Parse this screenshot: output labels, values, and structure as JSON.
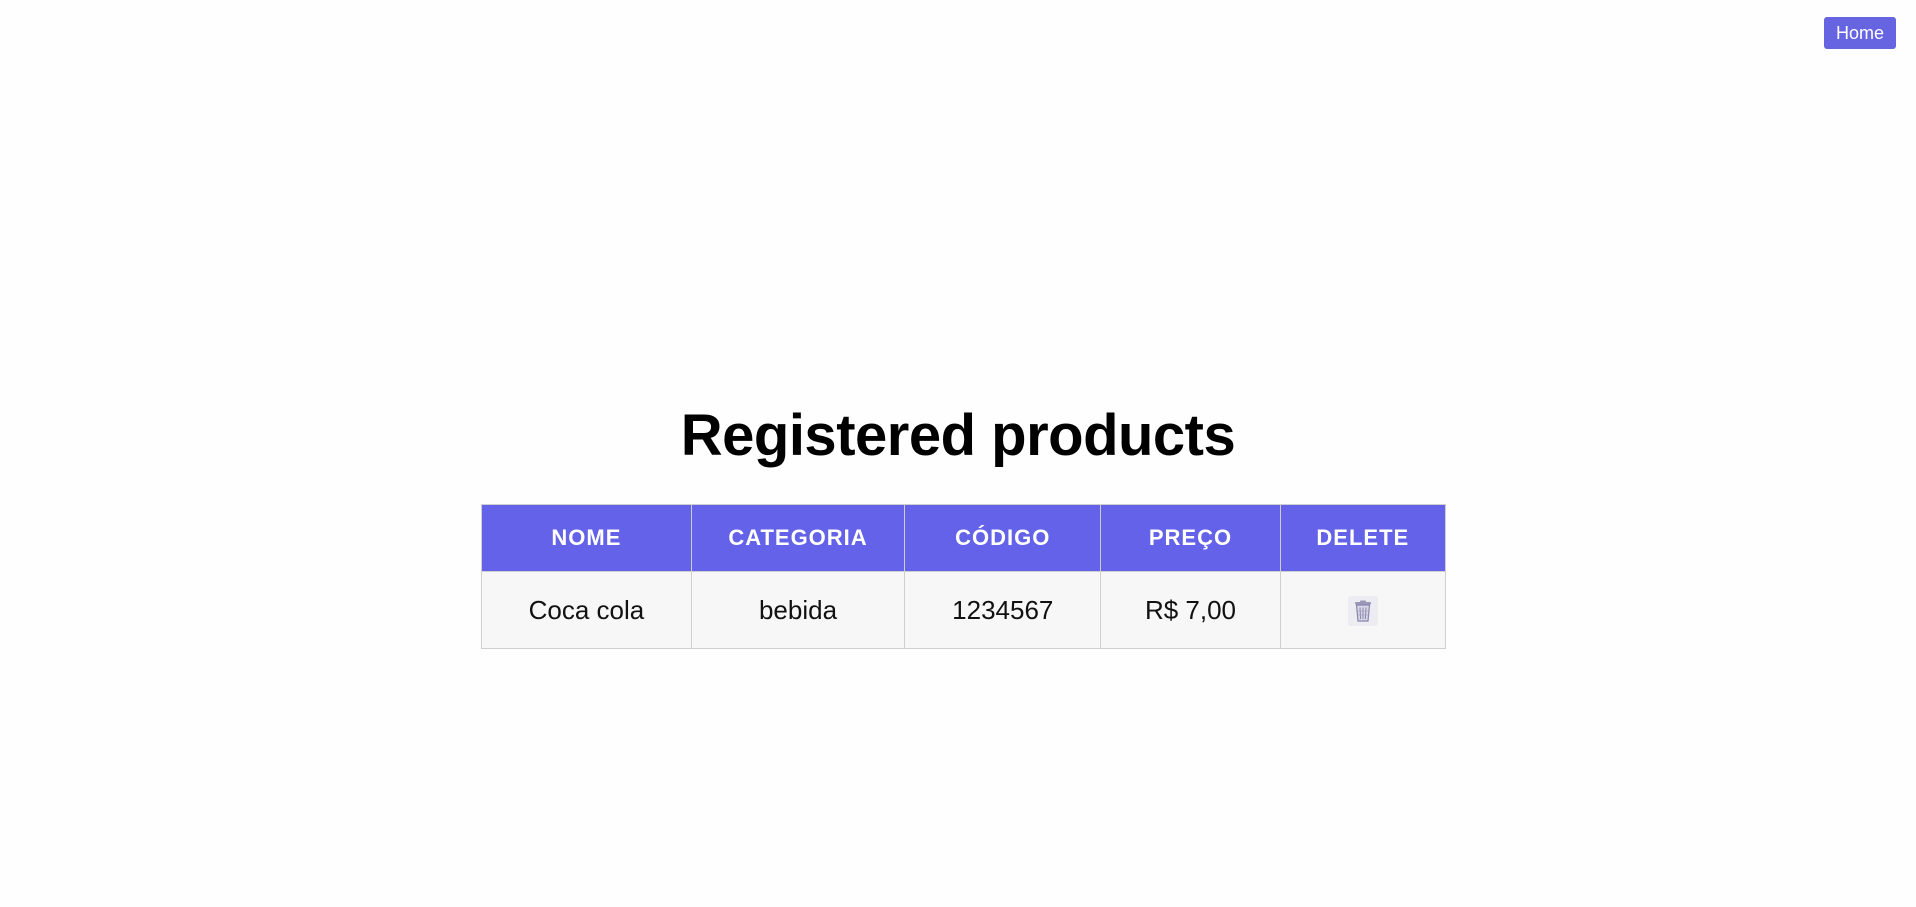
{
  "header": {
    "home_label": "Home"
  },
  "main": {
    "title": "Registered products",
    "table": {
      "headers": [
        "NOME",
        "CATEGORIA",
        "CÓDIGO",
        "PREÇO",
        "DELETE"
      ],
      "rows": [
        {
          "nome": "Coca cola",
          "categoria": "bebida",
          "codigo": "1234567",
          "preco": "R$ 7,00",
          "delete_icon": "trash-icon"
        }
      ]
    }
  },
  "colors": {
    "accent": "#6362e8",
    "button": "#6664e0",
    "row_background": "#f7f7f7"
  }
}
